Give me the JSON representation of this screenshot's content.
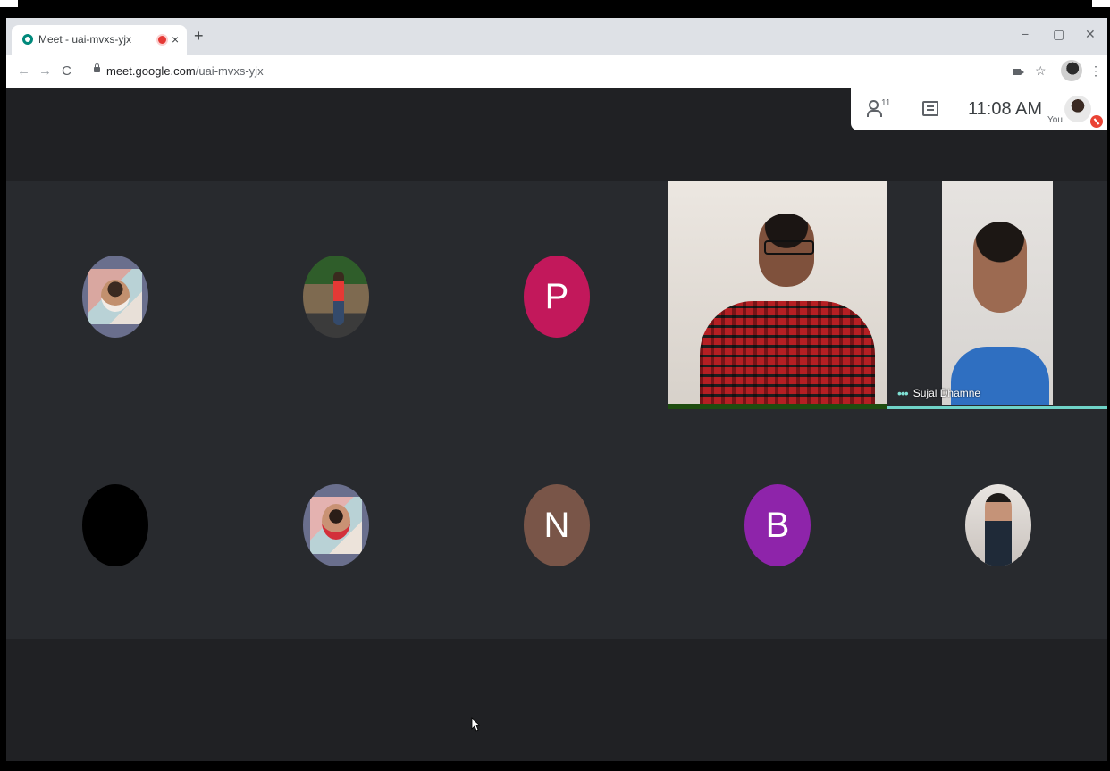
{
  "browser": {
    "tab_title": "Meet - uai-mvxs-yjx",
    "tab_close": "×",
    "new_tab": "+",
    "window": {
      "minimize": "−",
      "restore": "▢",
      "close": "✕"
    },
    "nav": {
      "back": "←",
      "forward": "→",
      "reload": "C"
    },
    "url_host": "meet.google.com",
    "url_path": "/uai-mvxs-yjx",
    "star": "☆",
    "menu": "⋮"
  },
  "meet": {
    "participants_count": "11",
    "time": "11:08 AM",
    "self_label": "You"
  },
  "grid": {
    "letters": [
      "P",
      "N",
      "B"
    ],
    "speaker_name": "Sujal Dhamne",
    "speaker_dots": "•••"
  },
  "colors": {
    "meet_bg": "#202124",
    "avatar_p": "#c2185b",
    "avatar_n": "#795548",
    "avatar_b": "#8e24aa",
    "speaking_accent": "#6fd3c8"
  }
}
